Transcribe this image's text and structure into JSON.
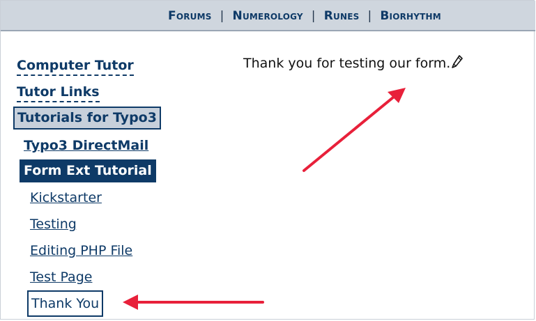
{
  "topnav": {
    "items": [
      "Forums",
      "Numerology",
      "Runes",
      "Biorhythm"
    ],
    "separator": "|"
  },
  "sidebar": {
    "items": [
      {
        "label": "Computer Tutor"
      },
      {
        "label": "Tutor Links"
      },
      {
        "label": "Tutorials for Typo3"
      },
      {
        "label": "Typo3 DirectMail"
      },
      {
        "label": "Form Ext Tutorial"
      }
    ],
    "subitems": [
      {
        "label": "Kickstarter"
      },
      {
        "label": "Testing"
      },
      {
        "label": "Editing PHP File"
      },
      {
        "label": "Test Page"
      },
      {
        "label": "Thank You"
      }
    ]
  },
  "main": {
    "message": "Thank you for testing our form."
  },
  "icons": {
    "message_icon": "pencil-icon",
    "annotation": "red-arrow-icon"
  },
  "colors": {
    "topbar_bg": "#cfd6de",
    "nav_text": "#0e3a67",
    "selected_bg": "#0e3a67",
    "active_bg": "#c7d0db",
    "arrow": "#e8203a"
  }
}
